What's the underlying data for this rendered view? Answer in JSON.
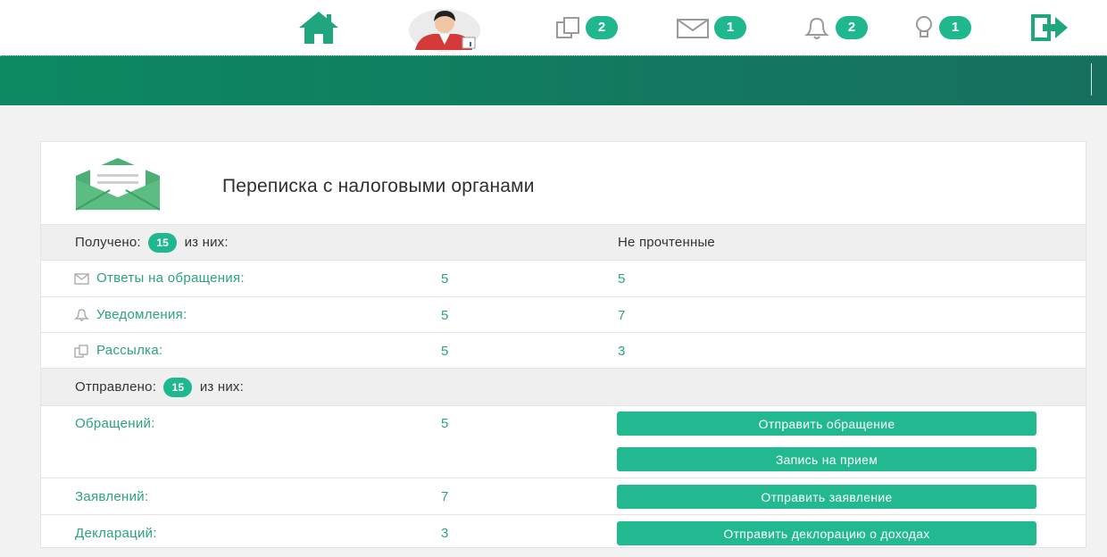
{
  "topbar": {
    "icons": [
      "home-icon",
      "user-avatar-icon",
      "copy-icon",
      "mail-icon",
      "bell-icon",
      "lightbulb-icon",
      "logout-icon"
    ],
    "badges": {
      "copy": "2",
      "mail": "1",
      "bell": "2",
      "bulb": "1"
    }
  },
  "colors": {
    "accent": "#1fb88e",
    "band": "#0c8963",
    "link": "#2aa37f"
  },
  "card": {
    "title": "Переписка с налоговыми органами",
    "received": {
      "prefix": "Получено:",
      "count": "15",
      "suffix": "из них:",
      "unread_header": "Не прочтенные",
      "rows": [
        {
          "icon": "mail-icon",
          "label": "Ответы на обращения:",
          "total": "5",
          "unread": "5"
        },
        {
          "icon": "bell-icon",
          "label": "Уведомления:",
          "total": "5",
          "unread": "7"
        },
        {
          "icon": "copy-icon",
          "label": "Рассылка:",
          "total": "5",
          "unread": "3"
        }
      ]
    },
    "sent": {
      "prefix": "Отправлено:",
      "count": "15",
      "suffix": "из них:",
      "rows": [
        {
          "label": "Обращений:",
          "value": "5"
        },
        {
          "label": "Заявлений:",
          "value": "7"
        },
        {
          "label": "Деклараций:",
          "value": "3"
        }
      ]
    },
    "buttons": {
      "send_appeal": "Отправить обращение",
      "appointment": "Запись на прием",
      "send_application": "Отправить заявление",
      "send_declaration": "Отправить деклорацию о доходах"
    }
  }
}
